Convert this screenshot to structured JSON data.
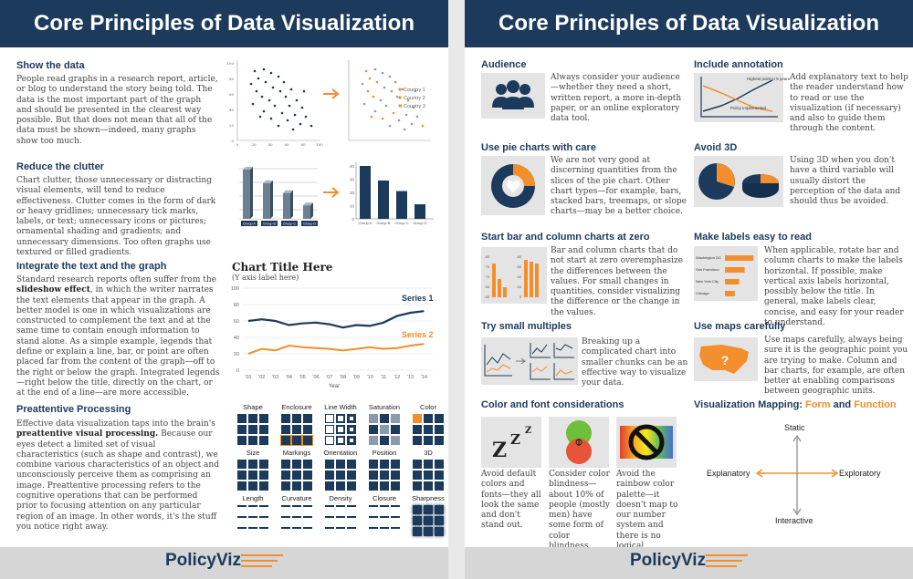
{
  "left": {
    "title": "Core Principles of Data Visualization",
    "show": {
      "heading": "Show the data",
      "body": "People read graphs in a research report, article, or blog to understand the story being told. The data is the most important part of the graph and should be presented in the clearest way possible. But that does not mean that all of the data must be shown—indeed, many graphs show too much.",
      "axis_left": [
        "0",
        "20",
        "40",
        "60",
        "80",
        "100"
      ],
      "axis_bottom": [
        "0",
        "20",
        "40",
        "60",
        "80",
        "100"
      ],
      "legend": [
        "Country 1",
        "Country 2",
        "Country 3"
      ]
    },
    "clutter": {
      "heading": "Reduce the clutter",
      "body": "Chart clutter, those unnecessary or distracting visual elements, will tend to reduce effectiveness. Clutter comes in the form of dark or heavy gridlines; unnecessary tick marks, labels, or text; unnecessary icons or pictures; ornamental shading and gradients; and unnecessary dimensions. Too often graphs use textured or filled gradients.",
      "groups": [
        "Group A",
        "Group B",
        "Group C",
        "Group D"
      ],
      "values": [
        40,
        29,
        21,
        11
      ],
      "yticks": [
        "0",
        "10",
        "20",
        "30",
        "40"
      ]
    },
    "integrate": {
      "heading": "Integrate the text and the graph",
      "body_pre": "Standard research reports often suffer from the ",
      "body_bold": "slideshow effect",
      "body_post": ", in which the writer narrates the text elements that appear in the graph. A better model is one in which visualizations are constructed to complement the text and at the same time to contain enough information to stand alone. As a simple example, legends that define or explain a line, bar, or point are often placed far from the content of the graph—off to the right or below the graph. Integrated legends—right below the title, directly on the chart, or at the end of a line—are more accessible.",
      "chart_title": "Chart Title Here",
      "chart_subtitle": "(Y axis label here)",
      "series1": "Series 1",
      "series2": "Series 2",
      "yticks": [
        "100",
        "80",
        "60",
        "40",
        "20",
        "0"
      ],
      "xticks": [
        "'01",
        "'02",
        "'03",
        "'04",
        "'05",
        "'06",
        "'07",
        "'08",
        "'09",
        "'10",
        "'11",
        "'12",
        "'13",
        "'14"
      ],
      "xlabel": "Year"
    },
    "preattentive": {
      "heading": "Preattentive Processing",
      "body_pre": "Effective data visualization taps into the brain's ",
      "body_bold": "preattentive visual processing.",
      "body_post": " Because our eyes detect a limited set of visual characteristics (such as shape and contrast), we combine various characteristics of an object and unconsciously perceive them as comprising an image. Preattentive processing refers to the cognitive operations that can be performed prior to focusing attention on any particular region of an image. In other words, it's the stuff you notice right away.",
      "labels": [
        "Shape",
        "Enclosure",
        "Line Width",
        "Saturation",
        "Color",
        "Size",
        "Markings",
        "Orientation",
        "Position",
        "3D",
        "Length",
        "Curvature",
        "Density",
        "Closure",
        "Sharpness"
      ]
    },
    "logo": "PolicyViz"
  },
  "right": {
    "title": "Core Principles of Data Visualization",
    "audience": {
      "heading": "Audience",
      "body": "Always consider your audience—whether they need a short, written report, a more in-depth paper, or an online exploratory data tool."
    },
    "annotation": {
      "heading": "Include annotation",
      "body": "Add explanatory text to help the reader understand how to read or use the visualization (if necessary) and also to guide them through the content.",
      "label1": "Highest point in 5 years",
      "label2": "Policy implemented"
    },
    "pie": {
      "heading": "Use pie charts with care",
      "body": "We are not very good at discerning quantities from the slices of the pie chart. Other chart types—for example, bars, stacked bars, treemaps, or slope charts—may be a better choice."
    },
    "avoid3d": {
      "heading": "Avoid 3D",
      "body": "Using 3D when you don't have a third variable will usually distort the perception of the data and should thus be avoided."
    },
    "zero": {
      "heading": "Start bar and column charts at zero",
      "body": "Bar and column charts that do not start at zero overemphasize the differences between the values. For small changes in quantities, consider visualizing the difference or the change in the values.",
      "ticks_a": [
        "80",
        "75",
        "70",
        "65",
        "60"
      ],
      "ticks_b": [
        "80",
        "60",
        "40",
        "20",
        "0"
      ]
    },
    "labels": {
      "heading": "Make labels easy to read",
      "body": "When applicable, rotate bar and column charts to make the labels horizontal. If possible, make vertical axis labels horizontal, possibly below the title. In general, make labels clear, concise, and easy for your reader to understand.",
      "bars": [
        "Washington DC",
        "San Francisco",
        "New York City",
        "Chicago"
      ]
    },
    "multiples": {
      "heading": "Try small multiples",
      "body": "Breaking up a complicated chart into smaller chunks can be an effective way to visualize your data."
    },
    "maps": {
      "heading": "Use maps carefully",
      "body": "Use maps carefully, always being sure it is the geographic point you are trying to make. Column and bar charts, for example, are often better at enabling comparisons between geographic units."
    },
    "colorfont": {
      "heading": "Color and font considerations",
      "col1": "Avoid default colors and fonts—they all look the same and don't stand out.",
      "col2": "Consider color blindness—about 10% of people (mostly men) have some form of color blindness.",
      "col3": "Avoid the rainbow color palette—it doesn't map to our number system and there is no logical ordering.",
      "zzz": "Z"
    },
    "mapping": {
      "heading_pre": "Visualization Mapping: ",
      "heading_form": "Form",
      "heading_and": " and ",
      "heading_function": "Function",
      "static": "Static",
      "interactive": "Interactive",
      "explanatory": "Explanatory",
      "exploratory": "Exploratory"
    },
    "logo": "PolicyViz"
  },
  "colors": {
    "navy": "#1c3a5c",
    "orange": "#f28e2b",
    "gray": "#e4e4e4"
  }
}
